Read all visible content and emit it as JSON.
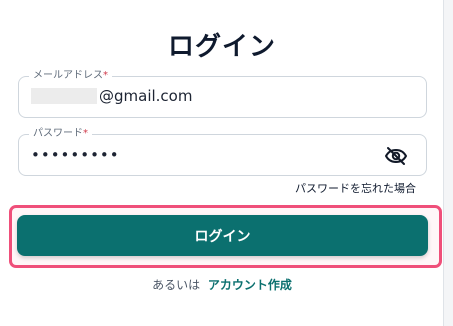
{
  "login": {
    "title": "ログイン",
    "email_label": "メールアドレス",
    "email_value": "@gmail.com",
    "password_label": "パスワード",
    "password_value": "•••••••••",
    "required_mark": "*",
    "forgot_link": "パスワードを忘れた場合",
    "submit_label": "ログイン",
    "signup_prefix": "あるいは",
    "signup_link": "アカウント作成"
  },
  "colors": {
    "primary": "#0b706f",
    "highlight": "#ef4f7a",
    "required": "#d03a4b"
  }
}
